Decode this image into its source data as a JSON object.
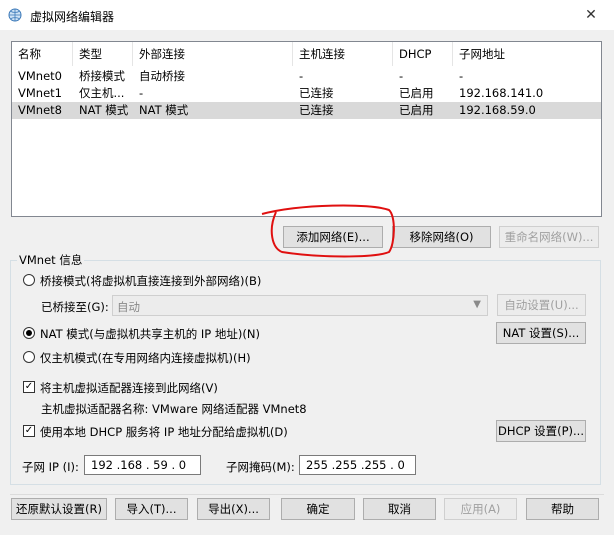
{
  "window": {
    "title": "虚拟网络编辑器",
    "close_label": "✕"
  },
  "table": {
    "columns": [
      "名称",
      "类型",
      "外部连接",
      "主机连接",
      "DHCP",
      "子网地址"
    ],
    "rows": [
      [
        "VMnet0",
        "桥接模式",
        "自动桥接",
        "-",
        "-",
        "-"
      ],
      [
        "VMnet1",
        "仅主机...",
        "-",
        "已连接",
        "已启用",
        "192.168.141.0"
      ],
      [
        "VMnet8",
        "NAT 模式",
        "NAT 模式",
        "已连接",
        "已启用",
        "192.168.59.0"
      ]
    ],
    "selected_row": 2
  },
  "table_buttons": {
    "add": "添加网络(E)...",
    "remove": "移除网络(O)",
    "rename": "重命名网络(W)..."
  },
  "vmnet_info": {
    "legend": "VMnet 信息",
    "bridged_label": "桥接模式(将虚拟机直接连接到外部网络)(B)",
    "bridged_to_label": "已桥接至(G):",
    "bridged_to_value": "自动",
    "auto_settings": "自动设置(U)...",
    "nat_label": "NAT 模式(与虚拟机共享主机的 IP 地址)(N)",
    "nat_settings": "NAT 设置(S)...",
    "hostonly_label": "仅主机模式(在专用网络内连接虚拟机)(H)",
    "selected_mode": "nat",
    "connect_adapter_label": "将主机虚拟适配器连接到此网络(V)",
    "connect_adapter_checked": true,
    "adapter_name_label": "主机虚拟适配器名称: VMware 网络适配器 VMnet8",
    "dhcp_label": "使用本地 DHCP 服务将 IP 地址分配给虚拟机(D)",
    "dhcp_checked": true,
    "dhcp_settings": "DHCP 设置(P)...",
    "subnet_ip_label": "子网 IP (I):",
    "subnet_ip_value": "192 .168 . 59  .  0",
    "subnet_mask_label": "子网掩码(M):",
    "subnet_mask_value": "255 .255 .255 .  0"
  },
  "footer": {
    "restore": "还原默认设置(R)",
    "import": "导入(T)...",
    "export": "导出(X)...",
    "ok": "确定",
    "cancel": "取消",
    "apply": "应用(A)",
    "help": "帮助"
  },
  "colors": {
    "annotation": "#e01010",
    "selected_row": "#d9d9d9"
  },
  "icons": {
    "app": "network-globe-icon",
    "close": "close-icon"
  }
}
